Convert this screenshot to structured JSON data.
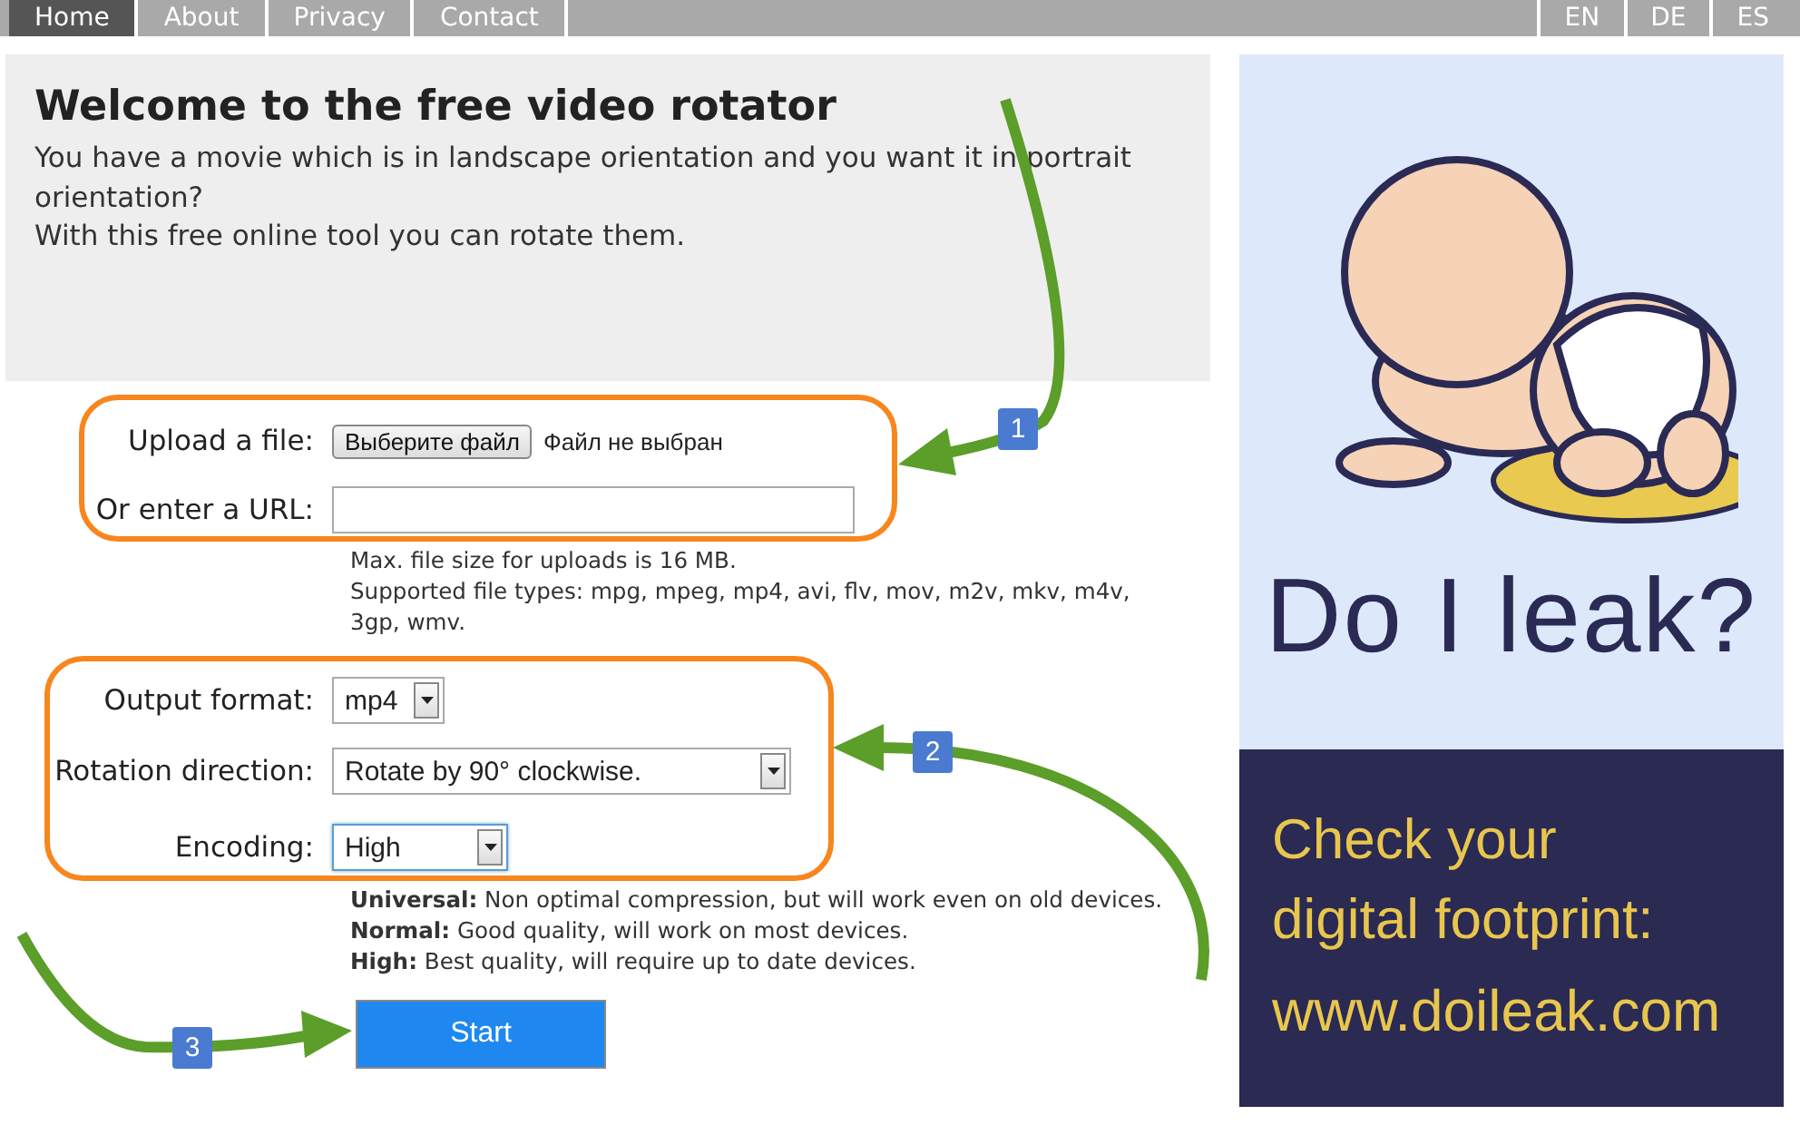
{
  "nav": {
    "links": [
      {
        "label": "Home",
        "selected": true
      },
      {
        "label": "About",
        "selected": false
      },
      {
        "label": "Privacy",
        "selected": false
      },
      {
        "label": "Contact",
        "selected": false
      }
    ],
    "languages": [
      "EN",
      "DE",
      "ES"
    ]
  },
  "welcome": {
    "title": "Welcome to the free video rotator",
    "paragraphs": [
      "You have a movie which is in landscape orientation and you want it in portrait orientation?",
      "With this free online tool you can rotate them."
    ]
  },
  "upload": {
    "file_label": "Upload a file:",
    "file_button": "Выберите файл",
    "file_status": "Файл не выбран",
    "url_label": "Or enter a URL:",
    "hints": [
      "Max. file size for uploads is 16 MB.",
      "Supported file types: mpg, mpeg, mp4, avi, flv, mov, m2v, mkv, m4v, 3gp, wmv."
    ]
  },
  "settings": [
    {
      "label": "Output format:",
      "value": "mp4",
      "focused": false
    },
    {
      "label": "Rotation direction:",
      "value": "Rotate by 90° clockwise.",
      "focused": false
    },
    {
      "label": "Encoding:",
      "value": "High",
      "focused": true
    }
  ],
  "encoding_notes": [
    "**Universal:** Non optimal compression, but will work even on old devices.",
    "**Normal:** Good quality, will work on most devices.",
    "**High:** Best quality, will require up to date devices."
  ],
  "start_button": "Start",
  "annotations": {
    "badges": [
      "1",
      "2",
      "3"
    ]
  },
  "ad": {
    "headline": "Do I leak?",
    "tagline": "Check your digital footprint:",
    "url": "www.doileak.com"
  }
}
